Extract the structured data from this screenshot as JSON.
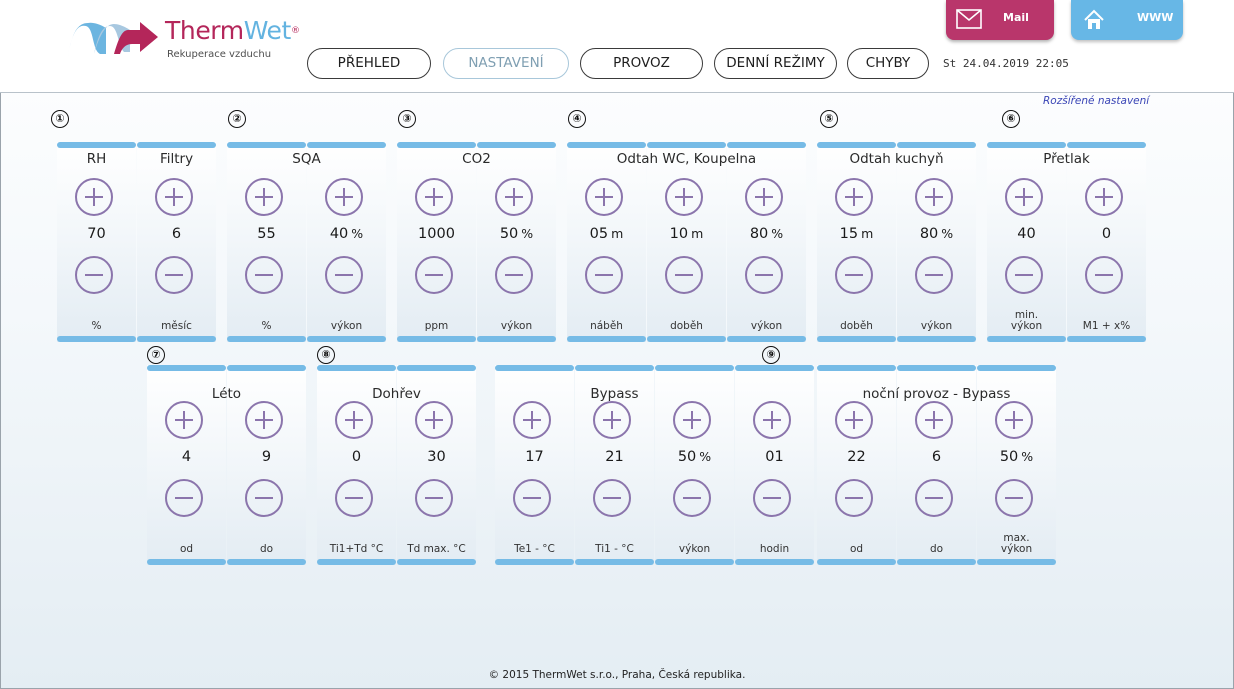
{
  "brand": {
    "part_a": "Therm",
    "part_b": "Wet",
    "reg": "®",
    "tagline": "Rekuperace vzduchu"
  },
  "header_buttons": {
    "mail": "Mail",
    "www": "WWW"
  },
  "nav": {
    "tabs": [
      "PŘEHLED",
      "NASTAVENÍ",
      "PROVOZ",
      "DENNÍ REŽIMY",
      "CHYBY"
    ],
    "active": "NASTAVENÍ"
  },
  "datetime": "St 24.04.2019  22:05",
  "advanced_link": "Rozšířené nastavení",
  "colors": {
    "accent_bar": "#76bbe6",
    "button_ring": "#8b75ac",
    "mail": "#b9366b",
    "www": "#67b7e6"
  },
  "row1": {
    "badges": [
      "①",
      "②",
      "③",
      "④",
      "⑤",
      "⑥"
    ],
    "titles": [
      "RH",
      "Filtry",
      "SQA",
      "CO2",
      "Odtah WC, Koupelna",
      "Odtah kuchyň",
      "Přetlak"
    ],
    "columns": [
      {
        "value": "70",
        "unit": "",
        "label": "%"
      },
      {
        "value": "6",
        "unit": "",
        "label": "měsíc"
      },
      {
        "value": "55",
        "unit": "",
        "label": "%"
      },
      {
        "value": "40",
        "unit": "%",
        "label": "výkon"
      },
      {
        "value": "1000",
        "unit": "",
        "label": "ppm"
      },
      {
        "value": "50",
        "unit": "%",
        "label": "výkon"
      },
      {
        "value": "05",
        "unit": "m",
        "label": "náběh"
      },
      {
        "value": "10",
        "unit": "m",
        "label": "doběh"
      },
      {
        "value": "80",
        "unit": "%",
        "label": "výkon"
      },
      {
        "value": "15",
        "unit": "m",
        "label": "doběh"
      },
      {
        "value": "80",
        "unit": "%",
        "label": "výkon"
      },
      {
        "value": "40",
        "unit": "",
        "label": "min.",
        "label2": "výkon"
      },
      {
        "value": "0",
        "unit": "",
        "label": "M1 + x%"
      }
    ]
  },
  "row2": {
    "badges": [
      "⑦",
      "⑧",
      "⑨"
    ],
    "titles": [
      "Léto",
      "Dohřev",
      "Bypass",
      "noční provoz - Bypass"
    ],
    "columns": [
      {
        "value": "4",
        "unit": "",
        "label": "od"
      },
      {
        "value": "9",
        "unit": "",
        "label": "do"
      },
      {
        "value": "0",
        "unit": "",
        "label": "Ti1+Td °C"
      },
      {
        "value": "30",
        "unit": "",
        "label": "Td max. °C"
      },
      {
        "value": "17",
        "unit": "",
        "label": "Te1 - °C"
      },
      {
        "value": "21",
        "unit": "",
        "label": "Ti1 - °C"
      },
      {
        "value": "50",
        "unit": "%",
        "label": "výkon"
      },
      {
        "value": "01",
        "unit": "",
        "label": "hodin"
      },
      {
        "value": "22",
        "unit": "",
        "label": "od"
      },
      {
        "value": "6",
        "unit": "",
        "label": "do"
      },
      {
        "value": "50",
        "unit": "%",
        "label": "max.",
        "label2": "výkon"
      }
    ]
  },
  "footer": "© 2015 ThermWet s.r.o., Praha, Česká republika."
}
